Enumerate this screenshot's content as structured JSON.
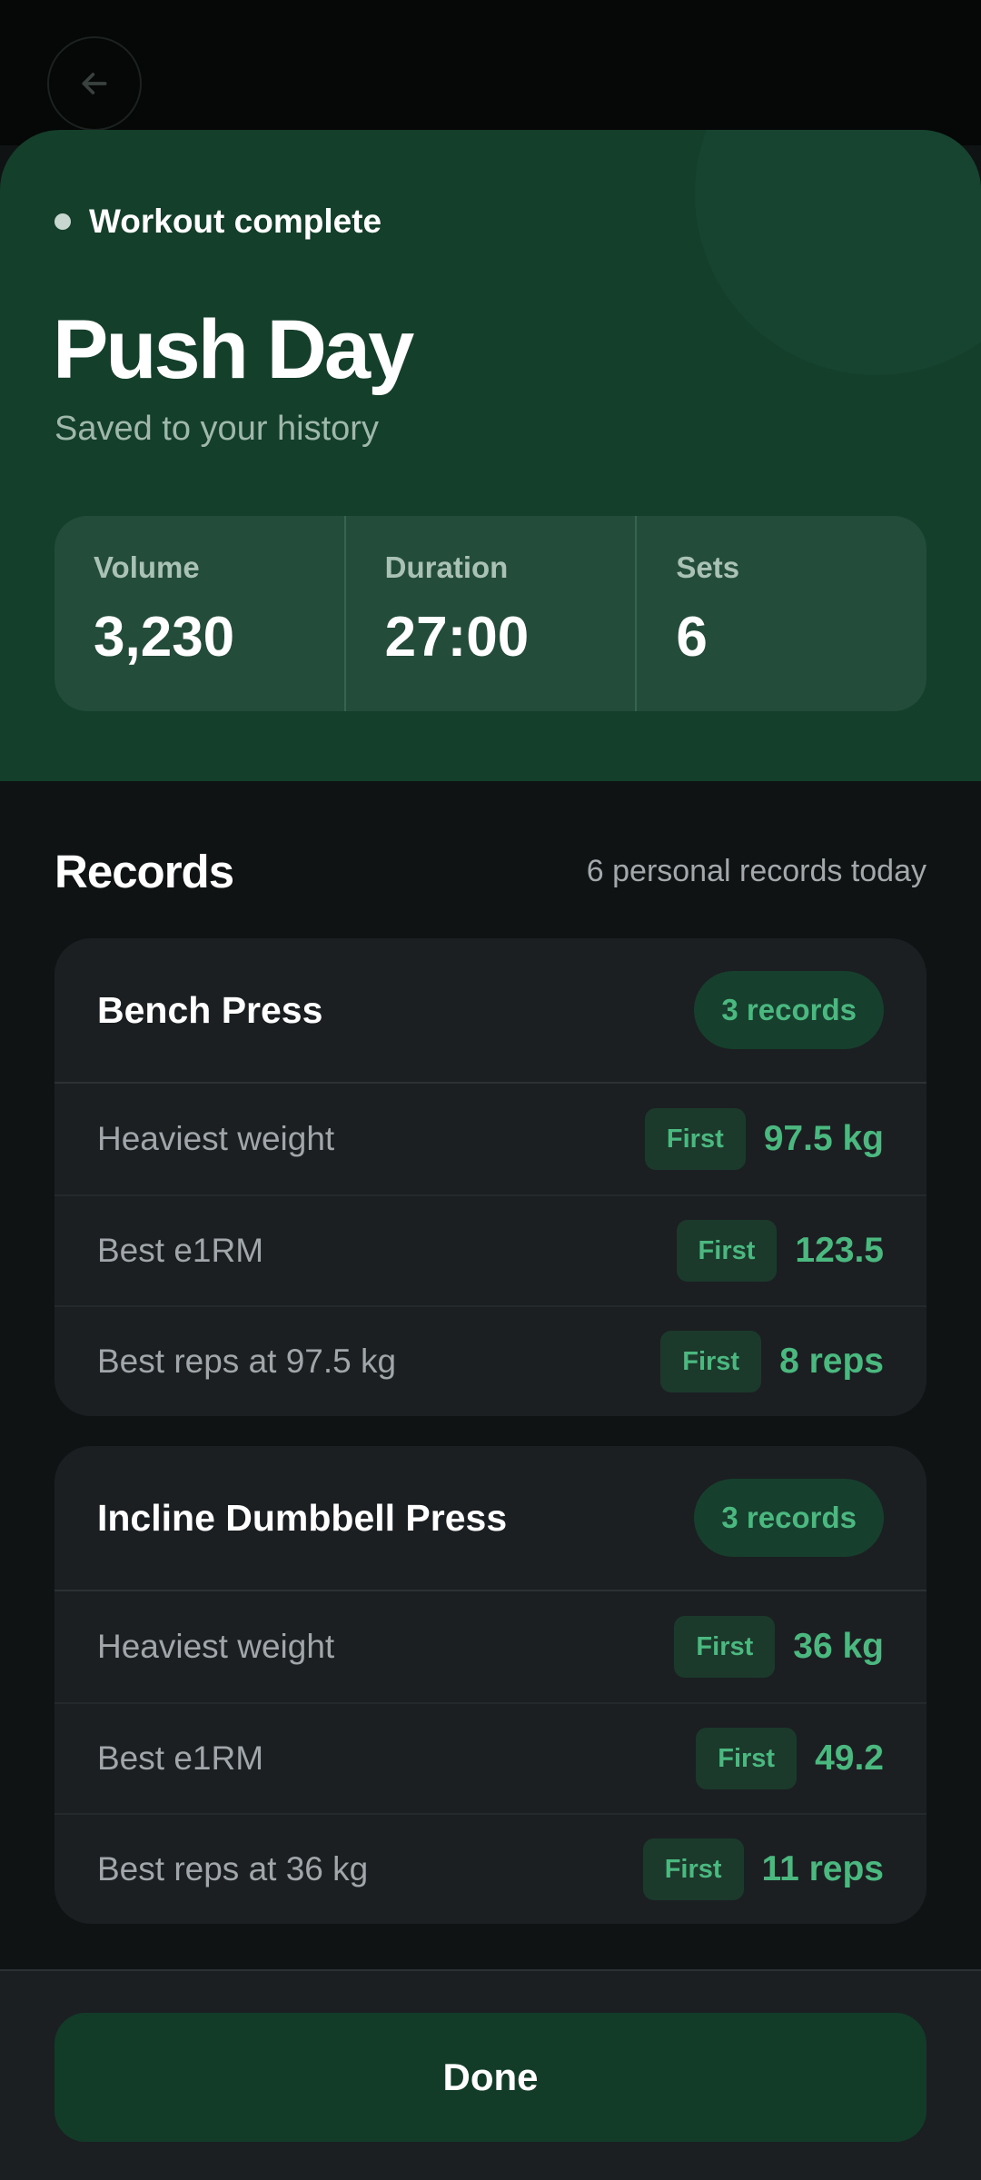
{
  "header": {
    "back_icon": "arrow-left-icon"
  },
  "hero": {
    "status": "Workout complete",
    "title": "Push Day",
    "subtitle": "Saved to your history",
    "stats": [
      {
        "label": "Volume",
        "value": "3,230"
      },
      {
        "label": "Duration",
        "value": "27:00"
      },
      {
        "label": "Sets",
        "value": "6"
      }
    ]
  },
  "records": {
    "title": "Records",
    "summary": "6 personal records today",
    "exercises": [
      {
        "name": "Bench Press",
        "count": "3 records",
        "rows": [
          {
            "label": "Heaviest weight",
            "badge": "First",
            "value": "97.5 kg"
          },
          {
            "label": "Best e1RM",
            "badge": "First",
            "value": "123.5"
          },
          {
            "label": "Best reps at 97.5 kg",
            "badge": "First",
            "value": "8 reps"
          }
        ]
      },
      {
        "name": "Incline Dumbbell Press",
        "count": "3 records",
        "rows": [
          {
            "label": "Heaviest weight",
            "badge": "First",
            "value": "36 kg"
          },
          {
            "label": "Best e1RM",
            "badge": "First",
            "value": "49.2"
          },
          {
            "label": "Best reps at 36 kg",
            "badge": "First",
            "value": "11 reps"
          }
        ]
      }
    ]
  },
  "footer": {
    "done_label": "Done"
  },
  "colors": {
    "accent": "#4bb880",
    "hero_bg": "#133f2b",
    "surface": "#1b1f22",
    "button_bg": "#123c28"
  }
}
